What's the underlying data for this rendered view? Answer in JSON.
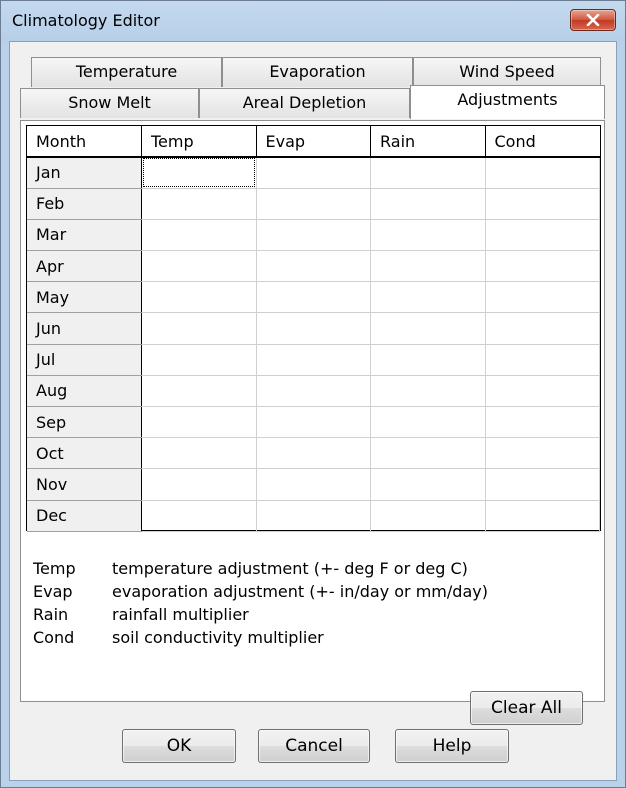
{
  "window": {
    "title": "Climatology Editor",
    "close_icon": "close-x-icon"
  },
  "tabs": {
    "row1": [
      {
        "label": "Temperature"
      },
      {
        "label": "Evaporation"
      },
      {
        "label": "Wind Speed"
      }
    ],
    "row2": [
      {
        "label": "Snow Melt"
      },
      {
        "label": "Areal Depletion"
      },
      {
        "label": "Adjustments",
        "active": true
      }
    ]
  },
  "grid": {
    "headers": [
      "Month",
      "Temp",
      "Evap",
      "Rain",
      "Cond"
    ],
    "months": [
      "Jan",
      "Feb",
      "Mar",
      "Apr",
      "May",
      "Jun",
      "Jul",
      "Aug",
      "Sep",
      "Oct",
      "Nov",
      "Dec"
    ]
  },
  "legend": [
    {
      "key": "Temp",
      "desc": "temperature adjustment (+- deg F or deg C)"
    },
    {
      "key": "Evap",
      "desc": "evaporation adjustment (+- in/day or mm/day)"
    },
    {
      "key": "Rain",
      "desc": "rainfall multiplier"
    },
    {
      "key": "Cond",
      "desc": "soil conductivity multiplier"
    }
  ],
  "buttons": {
    "clear_all": "Clear All",
    "ok": "OK",
    "cancel": "Cancel",
    "help": "Help"
  },
  "colors": {
    "close_button": "#c74a32",
    "frame": "#b9d1ea"
  }
}
